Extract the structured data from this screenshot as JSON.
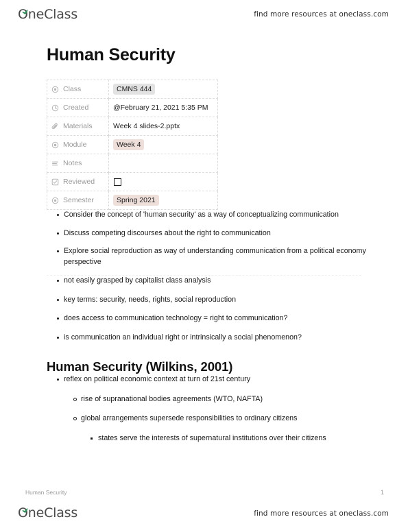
{
  "header": {
    "brand_name": "OneClass",
    "tagline": "find more resources at oneclass.com"
  },
  "document": {
    "title": "Human Security"
  },
  "meta_table": {
    "rows": [
      {
        "icon": "circle-dot-icon",
        "label": "Class",
        "value": "CMNS 444",
        "value_style": "tag-gray"
      },
      {
        "icon": "clock-icon",
        "label": "Created",
        "value": "@February 21, 2021 5:35 PM",
        "value_style": "plain"
      },
      {
        "icon": "paperclip-icon",
        "label": "Materials",
        "value": "Week 4 slides-2.pptx",
        "value_style": "plain"
      },
      {
        "icon": "circle-dot-icon",
        "label": "Module",
        "value": "Week 4",
        "value_style": "tag-pink"
      },
      {
        "icon": "list-lines-icon",
        "label": "Notes",
        "value": "",
        "value_style": "plain"
      },
      {
        "icon": "checkbox-icon",
        "label": "Reviewed",
        "value": "",
        "value_style": "checkbox"
      },
      {
        "icon": "circle-dot-icon",
        "label": "Semester",
        "value": "Spring 2021",
        "value_style": "tag-pink"
      }
    ]
  },
  "section_objectives": {
    "bullets": [
      "Consider the concept of 'human security' as a way of conceptualizing communication",
      "Discuss competing discourses about the right to communication",
      "Explore social reproduction as way of understanding communication from a political economy perspective"
    ]
  },
  "section_notes": {
    "bullets": [
      "not easily grasped by capitalist class analysis",
      "key terms: security, needs, rights, social reproduction",
      "does access to communication technology = right to communication?",
      "is communication an individual right or intrinsically a social phenomenon?"
    ]
  },
  "section_wilkins": {
    "heading": "Human Security (Wilkins, 2001)",
    "bullets": [
      {
        "level": 1,
        "text": "reflex on political economic context at turn of 21st century"
      },
      {
        "level": 2,
        "text": "rise of supranational bodies agreements (WTO, NAFTA)"
      },
      {
        "level": 2,
        "text": "global arrangements supersede responsibilities to ordinary citizens"
      },
      {
        "level": 3,
        "text": "states serve the interests of supernatural institutions over their citizens"
      }
    ]
  },
  "footer": {
    "doc_name": "Human Security",
    "page_number": "1",
    "brand_name": "OneClass",
    "tagline": "find more resources at oneclass.com"
  },
  "colors": {
    "tag_gray": "#e2e2e2",
    "tag_pink": "#efdfdb",
    "leaf_green": "#2e8b57",
    "muted_text": "#9a9a9a"
  }
}
